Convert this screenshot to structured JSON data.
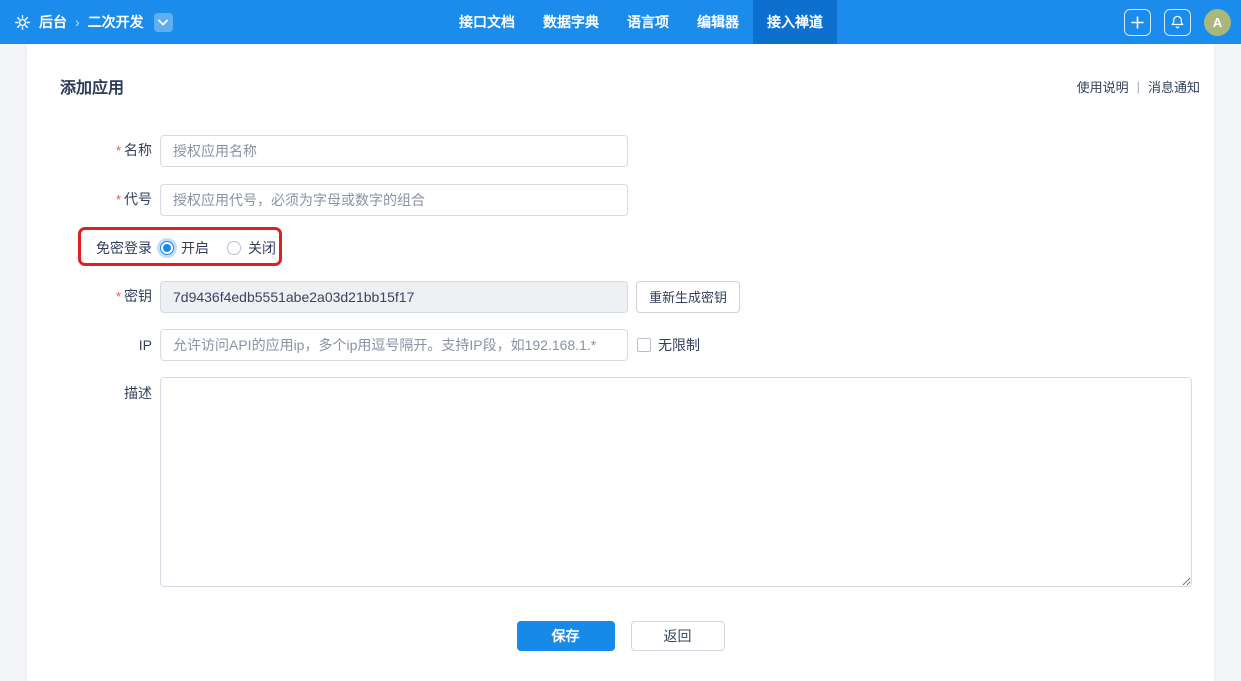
{
  "navbar": {
    "back_label": "后台",
    "crumb_sep": "›",
    "module_label": "二次开发",
    "items": [
      {
        "label": "接口文档",
        "active": false
      },
      {
        "label": "数据字典",
        "active": false
      },
      {
        "label": "语言项",
        "active": false
      },
      {
        "label": "编辑器",
        "active": false
      },
      {
        "label": "接入禅道",
        "active": true
      }
    ],
    "avatar_text": "A"
  },
  "page": {
    "title": "添加应用",
    "help_link": "使用说明",
    "link_divider": "|",
    "notice_link": "消息通知"
  },
  "form": {
    "name": {
      "label": "名称",
      "required": "*",
      "placeholder": "授权应用名称"
    },
    "code": {
      "label": "代号",
      "required": "*",
      "placeholder": "授权应用代号，必须为字母或数字的组合"
    },
    "free_login": {
      "label": "免密登录",
      "options": [
        {
          "label": "开启",
          "checked": true
        },
        {
          "label": "关闭",
          "checked": false
        }
      ]
    },
    "secret": {
      "label": "密钥",
      "required": "*",
      "value": "7d9436f4edb5551abe2a03d21bb15f17",
      "regen_button": "重新生成密钥"
    },
    "ip": {
      "label": "IP",
      "placeholder": "允许访问API的应用ip，多个ip用逗号隔开。支持IP段，如192.168.1.*",
      "unlimited_label": "无限制"
    },
    "desc": {
      "label": "描述"
    }
  },
  "actions": {
    "save": "保存",
    "back": "返回"
  },
  "colors": {
    "navbar_bg": "#1b8ceb",
    "navbar_active_bg": "#0d70cf",
    "accent_blue": "#1789e8",
    "highlight_red": "#e02020",
    "avatar_green": "#a9b87a",
    "required_red": "#f15352"
  }
}
